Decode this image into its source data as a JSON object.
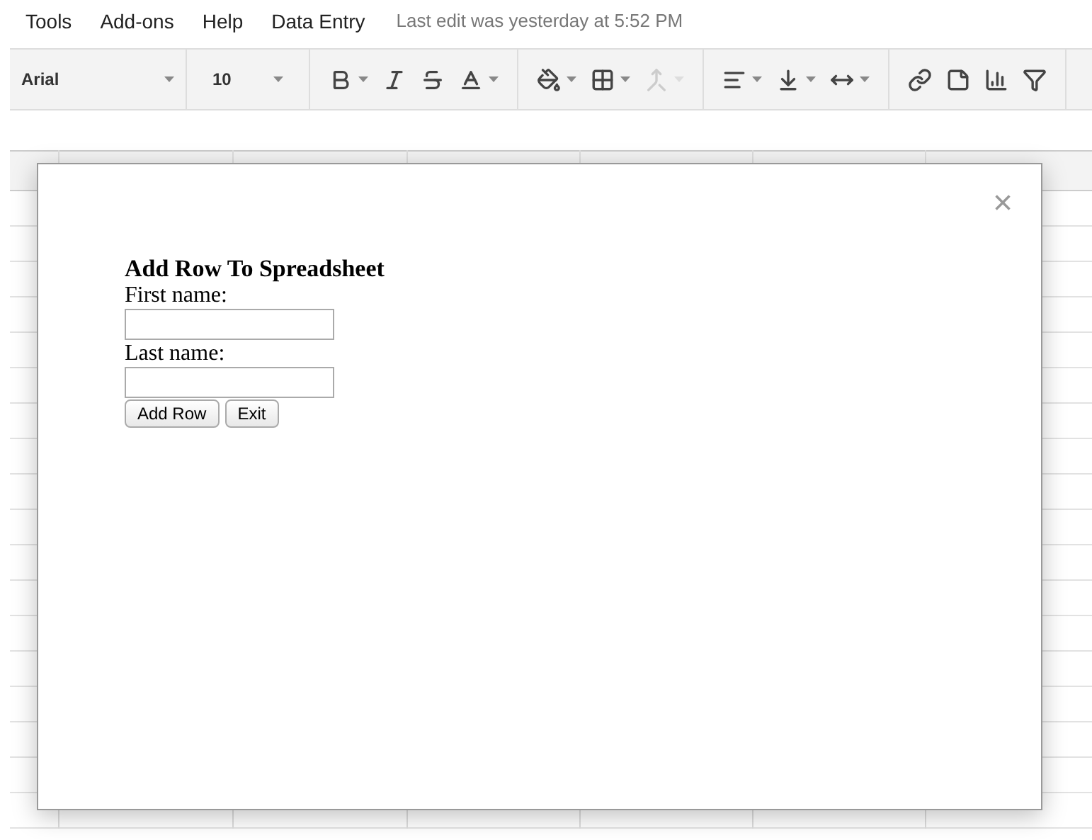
{
  "menu": [
    "Tools",
    "Add-ons",
    "Help",
    "Data Entry"
  ],
  "last_edit": "Last edit was yesterday at 5:52 PM",
  "toolbar": {
    "font": "Arial",
    "size": "10",
    "groups": [
      [
        {
          "kind": "bold",
          "disabled": false
        },
        {
          "kind": "italic",
          "disabled": false
        },
        {
          "kind": "strike",
          "disabled": false
        },
        {
          "kind": "textcolor",
          "disabled": false
        }
      ],
      [
        {
          "kind": "fill",
          "disabled": false
        },
        {
          "kind": "borders",
          "disabled": false
        },
        {
          "kind": "merge",
          "disabled": true
        }
      ],
      [
        {
          "kind": "align",
          "disabled": false
        },
        {
          "kind": "valign",
          "disabled": false
        },
        {
          "kind": "wrap",
          "disabled": false
        }
      ],
      [
        {
          "kind": "link",
          "disabled": false
        },
        {
          "kind": "comment",
          "disabled": false
        },
        {
          "kind": "chart",
          "disabled": false
        },
        {
          "kind": "filter",
          "disabled": false
        }
      ]
    ]
  },
  "dialog": {
    "close": "×",
    "title": "Add Row To Spreadsheet",
    "fields": [
      {
        "label": "First name:"
      },
      {
        "label": "Last name:"
      }
    ],
    "buttons": [
      "Add Row",
      "Exit"
    ]
  }
}
